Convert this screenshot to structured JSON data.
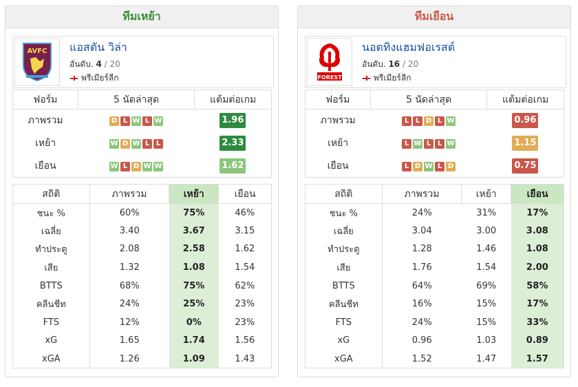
{
  "panels": [
    {
      "heading": "ทีมเหย้า",
      "heading_color": "#3a8a3a",
      "team_name": "แอสตัน วิล่า",
      "rank_prefix": "อันดับ. ",
      "rank": "4",
      "rank_of": " / 20",
      "league": "พรีเมียร์ลีก",
      "crest_icon": "aston-villa-crest",
      "form_headers": [
        "ฟอร์ม",
        "5 นัดล่าสุด",
        "แต้มต่อเกม"
      ],
      "form_rows": [
        {
          "label": "ภาพรวม",
          "results": [
            "D",
            "L",
            "W",
            "L",
            "W"
          ],
          "ppg": "1.96",
          "ppg_color": "#2e8b3e"
        },
        {
          "label": "เหย้า",
          "results": [
            "W",
            "D",
            "W",
            "L",
            "L"
          ],
          "ppg": "2.33",
          "ppg_color": "#2e8b3e"
        },
        {
          "label": "เยือน",
          "results": [
            "W",
            "L",
            "D",
            "W",
            "W"
          ],
          "ppg": "1.62",
          "ppg_color": "#8cc67a"
        }
      ],
      "stats_headers": [
        "สถิติ",
        "ภาพรวม",
        "เหย้า",
        "เยือน"
      ],
      "highlight_col": 2,
      "stats_rows": [
        [
          "ชนะ %",
          "60%",
          "75%",
          "46%"
        ],
        [
          "เฉลี่ย",
          "3.40",
          "3.67",
          "3.15"
        ],
        [
          "ทำประตู",
          "2.08",
          "2.58",
          "1.62"
        ],
        [
          "เสีย",
          "1.32",
          "1.08",
          "1.54"
        ],
        [
          "BTTS",
          "68%",
          "75%",
          "62%"
        ],
        [
          "คลีนชีท",
          "24%",
          "25%",
          "23%"
        ],
        [
          "FTS",
          "12%",
          "0%",
          "23%"
        ],
        [
          "xG",
          "1.65",
          "1.74",
          "1.56"
        ],
        [
          "xGA",
          "1.26",
          "1.09",
          "1.43"
        ]
      ]
    },
    {
      "heading": "ทีมเยือน",
      "heading_color": "#c9574b",
      "team_name": "นอตทิงแฮมฟอเรสต์",
      "rank_prefix": "อันดับ. ",
      "rank": "16",
      "rank_of": " / 20",
      "league": "พรีเมียร์ลีก",
      "crest_icon": "nottingham-forest-crest",
      "form_headers": [
        "ฟอร์ม",
        "5 นัดล่าสุด",
        "แต้มต่อเกม"
      ],
      "form_rows": [
        {
          "label": "ภาพรวม",
          "results": [
            "L",
            "L",
            "D",
            "L",
            "W"
          ],
          "ppg": "0.96",
          "ppg_color": "#c9574b"
        },
        {
          "label": "เหย้า",
          "results": [
            "L",
            "W",
            "L",
            "L",
            "W"
          ],
          "ppg": "1.15",
          "ppg_color": "#e0ad55"
        },
        {
          "label": "เยือน",
          "results": [
            "L",
            "D",
            "W",
            "L",
            "D"
          ],
          "ppg": "0.75",
          "ppg_color": "#c9574b"
        }
      ],
      "stats_headers": [
        "สถิติ",
        "ภาพรวม",
        "เหย้า",
        "เยือน"
      ],
      "highlight_col": 3,
      "stats_rows": [
        [
          "ชนะ %",
          "24%",
          "31%",
          "17%"
        ],
        [
          "เฉลี่ย",
          "3.04",
          "3.00",
          "3.08"
        ],
        [
          "ทำประตู",
          "1.28",
          "1.46",
          "1.08"
        ],
        [
          "เสีย",
          "1.76",
          "1.54",
          "2.00"
        ],
        [
          "BTTS",
          "64%",
          "69%",
          "58%"
        ],
        [
          "คลีนชีท",
          "16%",
          "15%",
          "17%"
        ],
        [
          "FTS",
          "24%",
          "15%",
          "33%"
        ],
        [
          "xG",
          "0.96",
          "1.03",
          "0.89"
        ],
        [
          "xGA",
          "1.52",
          "1.47",
          "1.57"
        ]
      ]
    }
  ]
}
